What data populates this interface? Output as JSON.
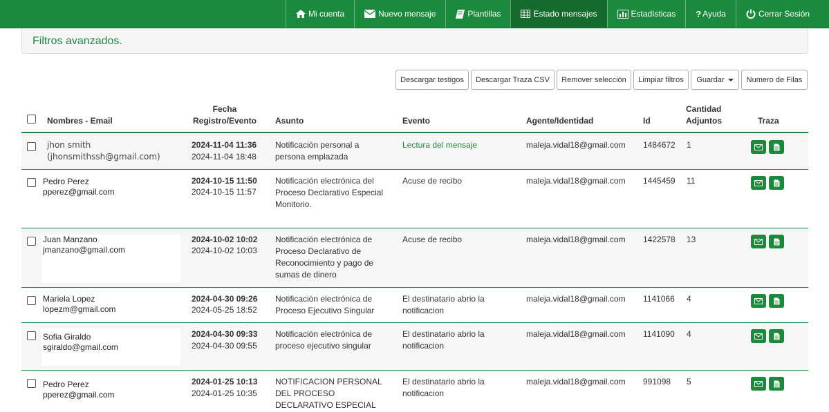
{
  "nav": [
    {
      "label": "Mi cuenta",
      "icon": "home-icon"
    },
    {
      "label": "Nuevo mensaje",
      "icon": "envelope-icon"
    },
    {
      "label": "Plantillas",
      "icon": "book-icon"
    },
    {
      "label": "Estado mensajes",
      "icon": "table-icon",
      "active": true
    },
    {
      "label": "Estadísticas",
      "icon": "bar-chart-icon"
    },
    {
      "label": "Ayuda",
      "icon": "question-icon"
    },
    {
      "label": "Cerrar Sesión",
      "icon": "power-icon"
    }
  ],
  "filters": {
    "label": "Filtros avanzados."
  },
  "toolbar": {
    "descargar_testigos": "Descargar testigos",
    "descargar_traza": "Descargar Traza CSV",
    "remover_seleccion": "Remover selección",
    "limpiar_filtros": "Limpiar filtros",
    "guardar": "Guardar",
    "numero_filas": "Numero de Filas"
  },
  "table": {
    "headers": {
      "nombres": "Nombres - Email",
      "fecha_1": "Fecha",
      "fecha_2": "Registro/Evento",
      "asunto": "Asunto",
      "evento": "Evento",
      "agente": "Agente/Identidad",
      "id": "Id",
      "cantidad_1": "Cantidad",
      "cantidad_2": "Adjuntos",
      "traza": "Traza"
    },
    "rows": [
      {
        "name": "jhon smith",
        "email": "(jhonsmithssh@gmail.com)",
        "registro": "2024-11-04 11:36",
        "evento_fecha": "2024-11-04 18:48",
        "asunto": [
          "Notificación personal a",
          "persona emplazada"
        ],
        "evento": [
          "Lectura del mensaje"
        ],
        "agente": "maleja.vidal18@gmail.com",
        "id": "1484672",
        "adjuntos": "1"
      },
      {
        "name": "Pedro Perez",
        "email": "pperez@gmail.com",
        "registro": "2024-10-15 11:50",
        "evento_fecha": "2024-10-15 11:57",
        "asunto": [
          "Notificación electrónica del",
          "Proceso Declarativo Especial",
          "Monitorio."
        ],
        "evento": [
          "Acuse de recibo"
        ],
        "agente": "maleja.vidal18@gmail.com",
        "id": "1445459",
        "adjuntos": "11"
      },
      {
        "name": "Juan Manzano",
        "email": "jmanzano@gmail.com",
        "registro": "2024-10-02 10:02",
        "evento_fecha": "2024-10-02 10:03",
        "asunto": [
          "Notificación electrónica de",
          "Proceso Declarativo de",
          "Reconocimiento y pago de",
          "sumas de dinero"
        ],
        "evento": [
          "Acuse de recibo"
        ],
        "agente": "maleja.vidal18@gmail.com",
        "id": "1422578",
        "adjuntos": "13"
      },
      {
        "name": "Mariela Lopez",
        "email": "lopezm@gmail.com",
        "registro": "2024-04-30 09:26",
        "evento_fecha": "2024-05-25 18:52",
        "asunto": [
          "Notificación electrónica de",
          "Proceso Ejecutivo Singular"
        ],
        "evento": [
          "El destinatario abrio la",
          "notificacion"
        ],
        "agente": "maleja.vidal18@gmail.com",
        "id": "1141066",
        "adjuntos": "4"
      },
      {
        "name": "Sofia Giraldo",
        "email": "sgiraldo@gmail.com",
        "registro": "2024-04-30 09:33",
        "evento_fecha": "2024-04-30 09:55",
        "asunto": [
          "Notificación electrónica de",
          "proceso ejecutivo singular"
        ],
        "evento": [
          "El destinatario abrio la",
          "notificacion"
        ],
        "agente": "maleja.vidal18@gmail.com",
        "id": "1141090",
        "adjuntos": "4"
      },
      {
        "name": "Pedro Perez",
        "email": "pperez@gmail.com",
        "registro": "2024-01-25 10:13",
        "evento_fecha": "2024-01-25 10:35",
        "asunto": [
          "NOTIFICACION PERSONAL",
          "DEL PROCESO",
          "DECLARATIVO ESPECIAL"
        ],
        "evento": [
          "El destinatario abrio la",
          "notificacion"
        ],
        "agente": "maleja.vidal18@gmail.com",
        "id": "991098",
        "adjuntos": "5"
      }
    ]
  }
}
